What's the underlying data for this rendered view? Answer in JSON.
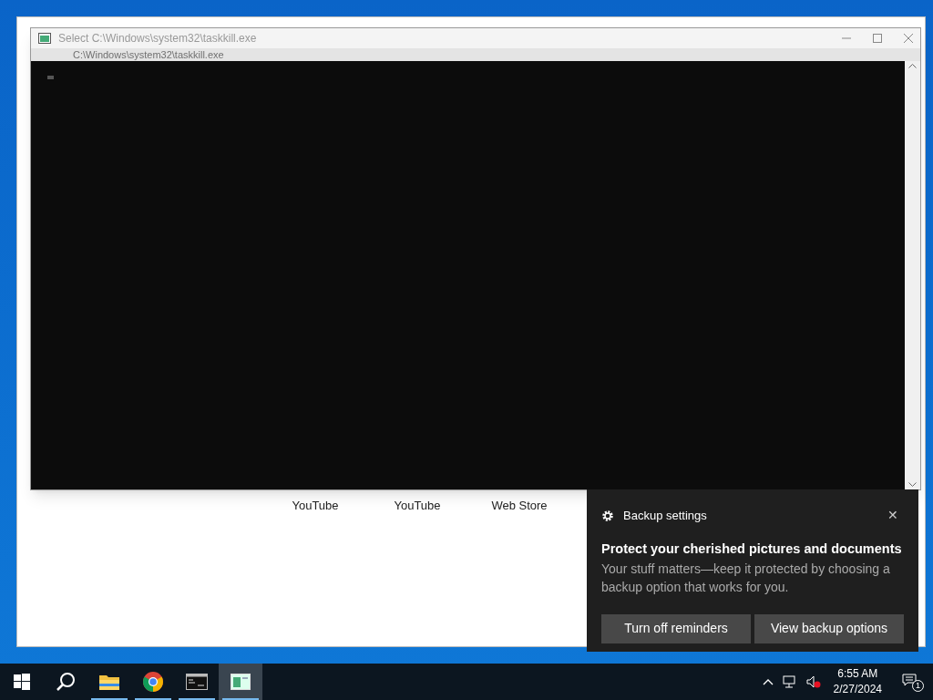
{
  "browser": {
    "shortcuts": [
      {
        "label": "YouTube"
      },
      {
        "label": "YouTube"
      },
      {
        "label": "Web Store"
      }
    ]
  },
  "console": {
    "title": "Select C:\\Windows\\system32\\taskkill.exe",
    "ghost_title": "C:\\Windows\\system32\\taskkill.exe"
  },
  "notification": {
    "app": "Backup settings",
    "close": "✕",
    "heading": "Protect your cherished pictures and documents",
    "body": "Your stuff matters—keep it protected by choosing a backup option that works for you.",
    "buttons": [
      "Turn off reminders",
      "View backup options"
    ]
  },
  "taskbar": {
    "items": [
      {
        "kind": "start",
        "running": false,
        "selected": false
      },
      {
        "kind": "search",
        "running": false,
        "selected": false
      },
      {
        "kind": "folder",
        "running": true,
        "selected": false
      },
      {
        "kind": "chrome",
        "running": true,
        "selected": false
      },
      {
        "kind": "console",
        "running": true,
        "selected": false
      },
      {
        "kind": "window",
        "running": true,
        "selected": true
      }
    ],
    "time": "6:55 AM",
    "date": "2/27/2024",
    "notification_count": "1"
  }
}
